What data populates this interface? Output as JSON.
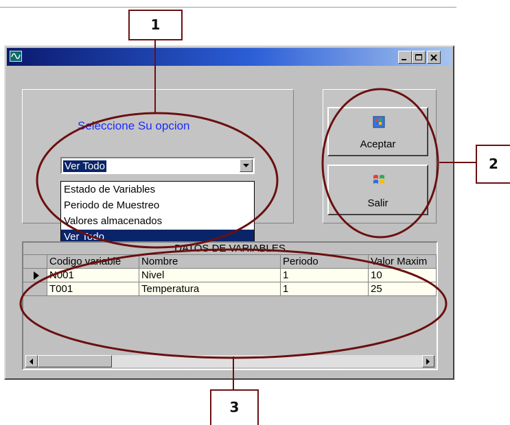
{
  "callouts": [
    "1",
    "2",
    "3"
  ],
  "window": {
    "title": "",
    "icon": "waveform-icon",
    "controls": [
      "minimize-icon",
      "maximize-icon",
      "close-icon"
    ],
    "title_gradient": [
      "#0a1a6e",
      "#a6c4ee"
    ]
  },
  "selector": {
    "prompt": "Seleccione Su opcion",
    "selected_value": "Ver Todo",
    "options": [
      "Estado de Variables",
      "Periodo de Muestreo",
      "Valores almacenados",
      "Ver Todo"
    ],
    "prompt_color": "#1c2cff",
    "highlight_color": "#0a246a"
  },
  "buttons": {
    "accept_label": "Aceptar",
    "accept_icon": "windows-document-icon",
    "exit_label": "Salir",
    "exit_icon": "windows-flag-icon"
  },
  "grid": {
    "title": "DATOS DE VARIABLES",
    "columns": [
      "Codigo variable",
      "Nombre",
      "Periodo",
      "Valor Maxim"
    ],
    "rows": [
      [
        "N001",
        "Nivel",
        "1",
        "10"
      ],
      [
        "T001",
        "Temperatura",
        "1",
        "25"
      ]
    ],
    "current_row_indicator": "row-pointer-icon"
  },
  "annotation_color": "#6b0f0f"
}
